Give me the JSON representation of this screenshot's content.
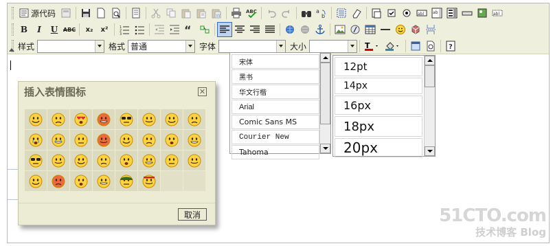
{
  "toolbar": {
    "source_label": "源代码",
    "style_label": "样式",
    "style_value": "",
    "format_label": "格式",
    "format_value": "普通",
    "font_label": "字体",
    "font_value": "",
    "size_label": "大小",
    "size_value": "",
    "bold": "B",
    "italic": "I",
    "underline": "U",
    "strike": "ABC",
    "subscript": "x₂",
    "superscript": "x²",
    "text_field_label": "abl",
    "hidden_field_label": "abl",
    "row1_icons": [
      "save-icon",
      "new-page-icon",
      "preview-icon",
      "templates-icon",
      "cut-icon",
      "copy-icon",
      "paste-icon",
      "paste-text-icon",
      "paste-word-icon",
      "print-icon",
      "spellcheck-icon",
      "undo-icon",
      "redo-icon",
      "find-icon",
      "replace-icon",
      "select-all-icon",
      "remove-format-icon",
      "form-icon",
      "checkbox-icon",
      "radio-icon",
      "textfield-icon",
      "textarea-icon",
      "select-icon",
      "button-icon",
      "image-button-icon",
      "hidden-field-icon"
    ],
    "row2_icons": [
      "bold-icon",
      "italic-icon",
      "underline-icon",
      "strike-icon",
      "subscript-icon",
      "superscript-icon",
      "ordered-list-icon",
      "unordered-list-icon",
      "outdent-icon",
      "indent-icon",
      "blockquote-icon",
      "div-icon",
      "align-left-icon",
      "align-center-icon",
      "align-right-icon",
      "align-justify-icon",
      "link-icon",
      "unlink-icon",
      "anchor-icon",
      "image-icon",
      "flash-icon",
      "table-icon",
      "horizontal-rule-icon",
      "smiley-icon",
      "special-char-icon",
      "page-break-icon"
    ]
  },
  "dialog": {
    "title": "插入表情图标",
    "cancel_label": "取消",
    "emoticons": [
      "smile",
      "sad",
      "love",
      "angry-steam",
      "cool-glasses",
      "surprised",
      "grimace",
      "shocked",
      "crying",
      "teary",
      "embarrassed",
      "mad-red",
      "content",
      "grinning",
      "confused",
      "worried",
      "cool-sunglasses",
      "sweating",
      "laughing",
      "thinking",
      "happy",
      "gasp",
      "puzzled",
      "frowning",
      "dizzy",
      "furious",
      "wink",
      "big-grin",
      "army-helmet",
      "headband"
    ]
  },
  "font_dropdown": {
    "items": [
      "宋体",
      "黑书",
      "华文行楷",
      "Arial",
      "Comic Sans MS",
      "Courier New",
      "Tahoma"
    ]
  },
  "size_dropdown": {
    "items": [
      "12pt",
      "14px",
      "16px",
      "18px",
      "20px"
    ]
  },
  "watermark": {
    "brand": "51CTO.com",
    "subtitle": "技术博客  Blog"
  }
}
